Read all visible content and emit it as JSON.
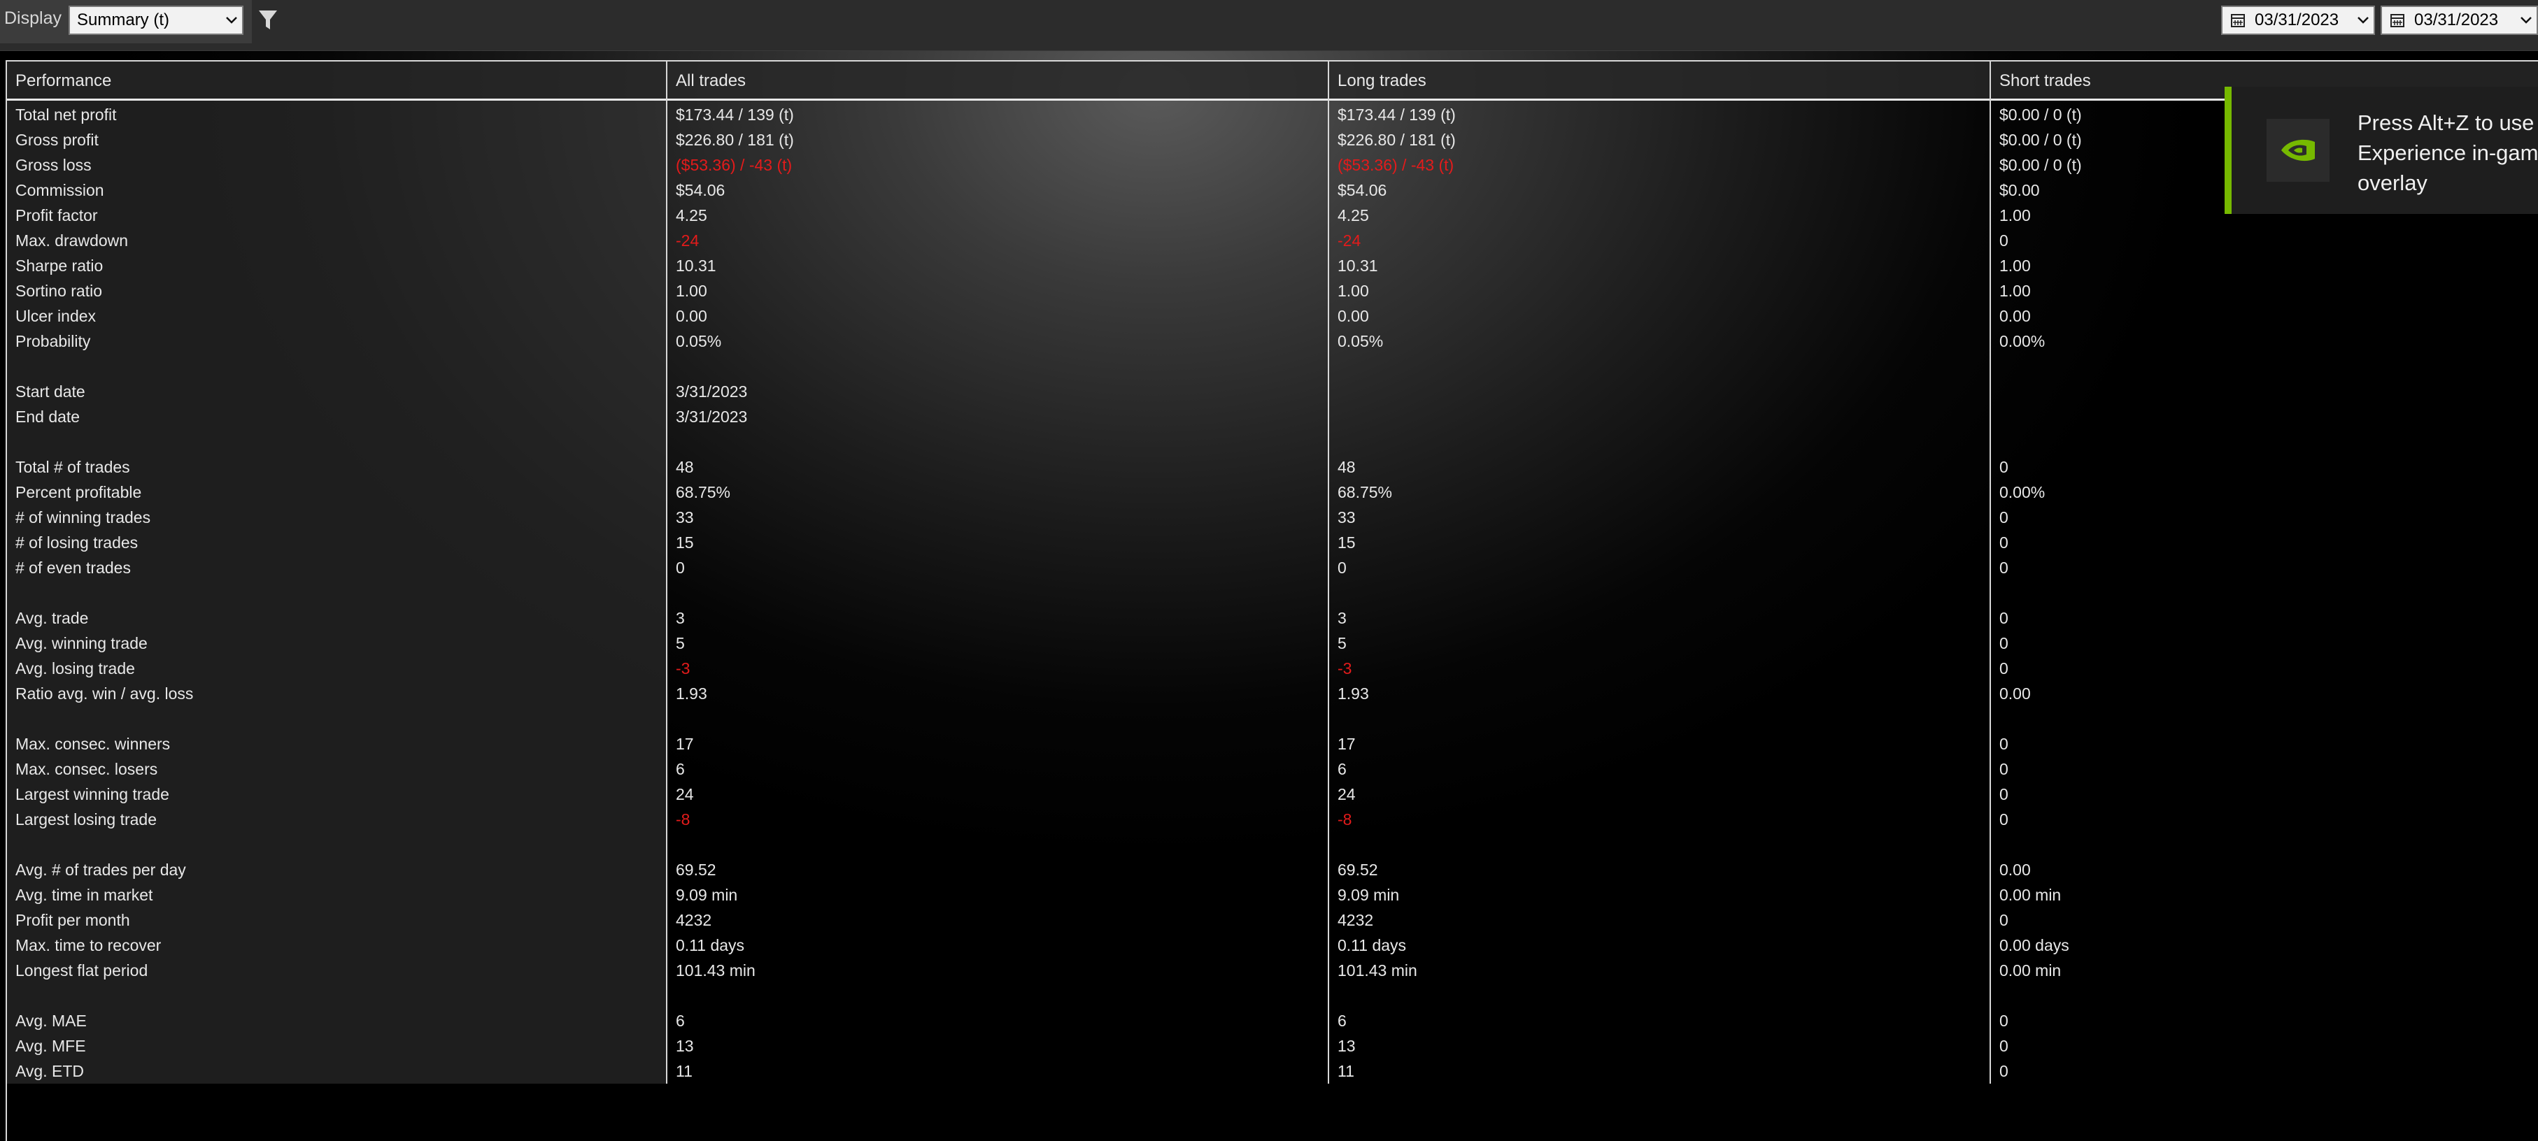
{
  "toolbar": {
    "display_label": "Display",
    "display_value": "Summary (t)",
    "date_from": "03/31/2023",
    "date_to": "03/31/2023"
  },
  "headers": [
    "Performance",
    "All trades",
    "Long trades",
    "Short trades"
  ],
  "rows": [
    {
      "label": "Total net profit",
      "all": "$173.44 / 139 (t)",
      "long": "$173.44 / 139 (t)",
      "short": "$0.00 / 0 (t)"
    },
    {
      "label": "Gross profit",
      "all": "$226.80 / 181 (t)",
      "long": "$226.80 / 181 (t)",
      "short": "$0.00 / 0 (t)"
    },
    {
      "label": "Gross loss",
      "all": "($53.36) / -43 (t)",
      "long": "($53.36) / -43 (t)",
      "short": "$0.00 / 0 (t)",
      "negative": true
    },
    {
      "label": "Commission",
      "all": "$54.06",
      "long": "$54.06",
      "short": "$0.00"
    },
    {
      "label": "Profit factor",
      "all": "4.25",
      "long": "4.25",
      "short": "1.00"
    },
    {
      "label": "Max. drawdown",
      "all": "-24",
      "long": "-24",
      "short": "0",
      "negative": true
    },
    {
      "label": "Sharpe ratio",
      "all": "10.31",
      "long": "10.31",
      "short": "1.00"
    },
    {
      "label": "Sortino ratio",
      "all": "1.00",
      "long": "1.00",
      "short": "1.00"
    },
    {
      "label": "Ulcer index",
      "all": "0.00",
      "long": "0.00",
      "short": "0.00"
    },
    {
      "label": "Probability",
      "all": "0.05%",
      "long": "0.05%",
      "short": "0.00%"
    },
    {
      "label": "",
      "all": "",
      "long": "",
      "short": ""
    },
    {
      "label": "Start date",
      "all": "3/31/2023",
      "long": "",
      "short": ""
    },
    {
      "label": "End date",
      "all": "3/31/2023",
      "long": "",
      "short": ""
    },
    {
      "label": "",
      "all": "",
      "long": "",
      "short": ""
    },
    {
      "label": "Total # of trades",
      "all": "48",
      "long": "48",
      "short": "0"
    },
    {
      "label": "Percent profitable",
      "all": "68.75%",
      "long": "68.75%",
      "short": "0.00%"
    },
    {
      "label": "# of winning trades",
      "all": "33",
      "long": "33",
      "short": "0"
    },
    {
      "label": "# of losing trades",
      "all": "15",
      "long": "15",
      "short": "0"
    },
    {
      "label": "# of even trades",
      "all": "0",
      "long": "0",
      "short": "0"
    },
    {
      "label": "",
      "all": "",
      "long": "",
      "short": ""
    },
    {
      "label": "Avg. trade",
      "all": "3",
      "long": "3",
      "short": "0"
    },
    {
      "label": "Avg. winning trade",
      "all": "5",
      "long": "5",
      "short": "0"
    },
    {
      "label": "Avg. losing trade",
      "all": "-3",
      "long": "-3",
      "short": "0",
      "negative": true
    },
    {
      "label": "Ratio avg. win / avg. loss",
      "all": "1.93",
      "long": "1.93",
      "short": "0.00"
    },
    {
      "label": "",
      "all": "",
      "long": "",
      "short": ""
    },
    {
      "label": "Max. consec. winners",
      "all": "17",
      "long": "17",
      "short": "0"
    },
    {
      "label": "Max. consec. losers",
      "all": "6",
      "long": "6",
      "short": "0"
    },
    {
      "label": "Largest winning trade",
      "all": "24",
      "long": "24",
      "short": "0"
    },
    {
      "label": "Largest losing trade",
      "all": "-8",
      "long": "-8",
      "short": "0",
      "negative": true
    },
    {
      "label": "",
      "all": "",
      "long": "",
      "short": ""
    },
    {
      "label": "Avg. # of trades per day",
      "all": "69.52",
      "long": "69.52",
      "short": "0.00"
    },
    {
      "label": "Avg. time in market",
      "all": "9.09 min",
      "long": "9.09 min",
      "short": "0.00 min"
    },
    {
      "label": "Profit per month",
      "all": "4232",
      "long": "4232",
      "short": "0"
    },
    {
      "label": "Max. time to recover",
      "all": "0.11 days",
      "long": "0.11 days",
      "short": "0.00 days"
    },
    {
      "label": "Longest flat period",
      "all": "101.43 min",
      "long": "101.43 min",
      "short": "0.00 min"
    },
    {
      "label": "",
      "all": "",
      "long": "",
      "short": ""
    },
    {
      "label": "Avg. MAE",
      "all": "6",
      "long": "6",
      "short": "0"
    },
    {
      "label": "Avg. MFE",
      "all": "13",
      "long": "13",
      "short": "0"
    },
    {
      "label": "Avg. ETD",
      "all": "11",
      "long": "11",
      "short": "0"
    }
  ],
  "overlay": {
    "text": "Press Alt+Z to use\nExperience in-gam\noverlay",
    "accent": "#76b900"
  },
  "colors": {
    "negative": "#e31b1b"
  },
  "icons": {
    "filter": "filter-icon",
    "calendar": "calendar-icon",
    "dropdown": "chevron-down-icon",
    "overlay_logo": "nvidia-logo-icon"
  }
}
